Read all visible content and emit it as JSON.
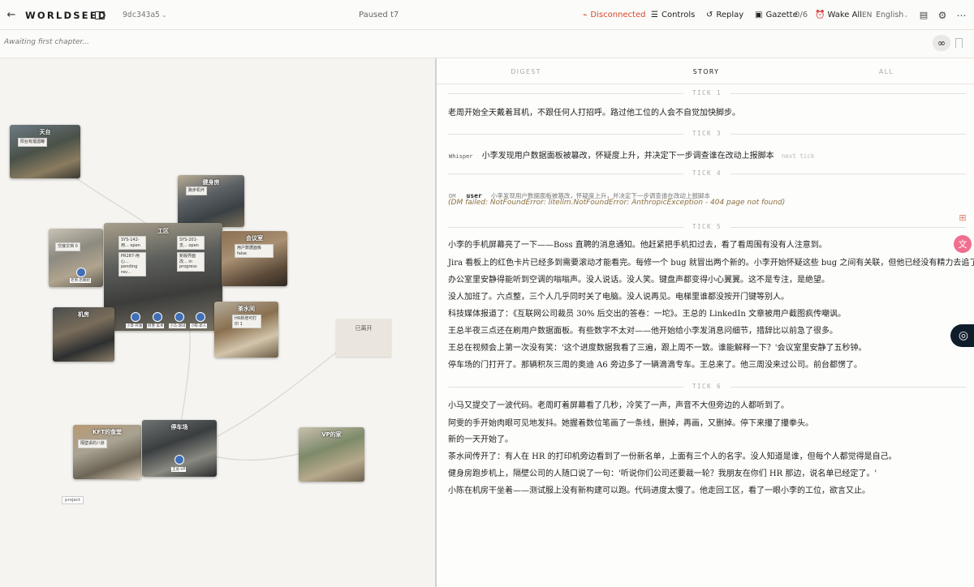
{
  "header": {
    "back_icon": "arrow-left-icon",
    "brand": "WORLDSEED",
    "hash": "9dc343a5",
    "status": "Paused",
    "tick": "t7",
    "connection": "Disconnected",
    "controls": "Controls",
    "replay": "Replay",
    "gazette": "Gazette",
    "gazette_count": "0/6",
    "wake": "Wake All",
    "lang_code": "EN",
    "lang_name": "English",
    "accent_error": "#d9462b"
  },
  "subbar": {
    "chapter_status": "Awaiting first chapter..."
  },
  "map": {
    "rooms": {
      "rooftop": {
        "title": "天台",
        "tag": "阳台有烟酒罐"
      },
      "gym": {
        "title": "健身房",
        "tag": "跑步机坏"
      },
      "workspace": {
        "title": "工区"
      },
      "meeting": {
        "title": "会议室",
        "tag": "用户数据面板 false"
      },
      "desk": {
        "tag": "交接文档 0"
      },
      "server": {
        "title": "机房"
      },
      "tea": {
        "title": "茶水间",
        "tag": "HR新增可打印 1"
      },
      "cafe": {
        "title": "KFT的食堂",
        "tag": "隔壁桌的八卦"
      },
      "parking": {
        "title": "停车场"
      },
      "vp_home": {
        "title": "VP的家"
      },
      "left": {
        "title": "已离开"
      }
    },
    "cards": {
      "sys142": "SYS-142-用... open",
      "sys201": "SYS-201-支... open",
      "pr287": "PR287-用心... pending rev...",
      "mobile": "新版界面改... in progress"
    },
    "avatars": {
      "lao_zhou": "老周·后端组",
      "xiao_li": "小李·开发",
      "a_wen": "阿雯·美术",
      "xiao_ma": "小马·测试",
      "xiao_chen": "小陈·新人",
      "wang_vp": "王总·VP"
    },
    "project_tag": "project"
  },
  "story": {
    "tabs": [
      "DIGEST",
      "STORY",
      "ALL"
    ],
    "active_tab": "STORY",
    "ticks": [
      {
        "label": "TICK 1"
      },
      {
        "label": "TICK 3"
      },
      {
        "label": "TICK 4"
      },
      {
        "label": "TICK 5"
      },
      {
        "label": "TICK 6"
      }
    ],
    "tick1_text": "老周开始全天戴着耳机，不跟任何人打招呼。路过他工位的人会不自觉加快脚步。",
    "whisper_tag": "Whisper",
    "whisper_text": "小李发现用户数据面板被篡改，怀疑度上升，并决定下一步调查谁在改动上报脚本",
    "next_tick": "next tick",
    "dm_tag": "DM",
    "dm_user": "user",
    "dm_text": "小李发现用户数据面板被篡改，怀疑度上升，并决定下一步调查谁在改动上报脚本",
    "dm_error": "(DM failed: NotFoundError: litellm.NotFoundError: AnthropicException - 404 page not found)",
    "tick5": [
      "小李的手机屏幕亮了一下——Boss 直聘的消息通知。他赶紧把手机扣过去，看了看周围有没有人注意到。",
      "Jira 看板上的红色卡片已经多到需要滚动才能看完。每修一个 bug 就冒出两个新的。小李开始怀疑这些 bug 之间有关联，但他已经没有精力去追了。",
      "办公室里安静得能听到空调的嗡嗡声。没人说话。没人笑。键盘声都变得小心翼翼。这不是专注，是绝望。",
      "没人加班了。六点整，三个人几乎同时关了电脑。没人说再见。电梯里谁都没按开门键等别人。",
      "科技媒体报道了：《互联网公司裁员 30% 后交出的答卷：一坨》。王总的 LinkedIn 文章被用户截图疯传嘲讽。",
      "王总半夜三点还在刷用户数据面板。有些数字不太对——他开始给小李发消息问细节，措辞比以前急了很多。",
      "王总在视频会上第一次没有笑：'这个进度数据我看了三遍，跟上周不一致。谁能解释一下？'会议室里安静了五秒钟。",
      "停车场的门打开了。那辆积灰三周的奥迪 A6 旁边多了一辆滴滴专车。王总来了。他三周没来过公司。前台都愣了。"
    ],
    "tick6": [
      "小马又提交了一波代码。老周盯着屏幕看了几秒，冷笑了一声，声音不大但旁边的人都听到了。",
      "阿雯的手开始肉眼可见地发抖。她握着数位笔画了一条线，删掉，再画，又删掉。停下来攥了攥拳头。",
      "新的一天开始了。",
      "茶水间传开了：有人在 HR 的打印机旁边看到了一份新名单，上面有三个人的名字。没人知道是谁，但每个人都觉得是自己。",
      "健身房跑步机上，隔壁公司的人随口说了一句：'听说你们公司还要裁一轮？我朋友在你们 HR 那边，说名单已经定了。'",
      "小陈在机房干坐着——测试服上没有新构建可以跑。代码进度太慢了。他走回工区，看了一眼小李的工位，欲言又止。"
    ]
  }
}
